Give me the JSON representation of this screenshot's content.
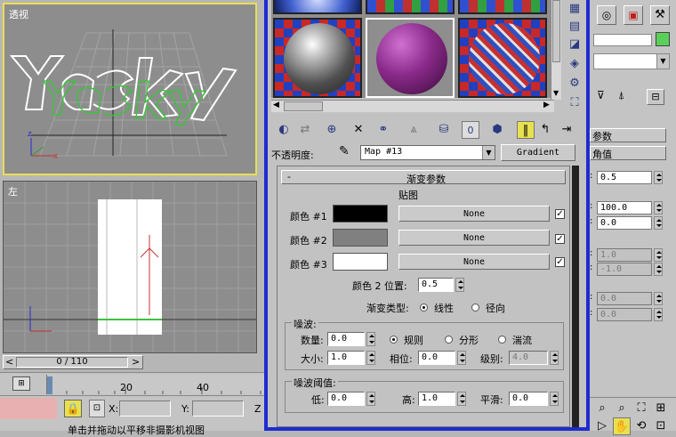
{
  "viewports": {
    "top_label": "透视",
    "bottom_label": "左"
  },
  "timeline": {
    "counter": "0 / 110",
    "tick_20": "20",
    "tick_40": "40"
  },
  "status": {
    "x_label": "X:",
    "y_label": "Y:",
    "z_label": "Z",
    "prompt": "单击并拖动以平移非摄影机视图"
  },
  "material_editor": {
    "opacity_label": "不透明度:",
    "map_name": "Map #13",
    "map_type": "Gradient",
    "rollout_collapse": "-",
    "rollout_title": "渐变参数",
    "maps_header": "贴图",
    "colors": [
      {
        "label": "颜色 #1",
        "swatch": "#000000",
        "map": "None",
        "checked": "✓"
      },
      {
        "label": "颜色 #2",
        "swatch": "#808080",
        "map": "None",
        "checked": "✓"
      },
      {
        "label": "颜色 #3",
        "swatch": "#ffffff",
        "map": "None",
        "checked": "✓"
      }
    ],
    "color2_pos_label": "颜色 2 位置:",
    "color2_pos_value": "0.5",
    "gradient_type_label": "渐变类型:",
    "gradient_types": [
      "线性",
      "径向"
    ],
    "noise_group": "噪波:",
    "amount_label": "数量:",
    "amount_value": "0.0",
    "noise_types": [
      "规则",
      "分形",
      "湍流"
    ],
    "size_label": "大小:",
    "size_value": "1.0",
    "phase_label": "相位:",
    "phase_value": "0.0",
    "levels_label": "级别:",
    "levels_value": "4.0",
    "threshold_group": "噪波阈值:",
    "low_label": "低:",
    "low_value": "0.0",
    "high_label": "高:",
    "high_value": "1.0",
    "smooth_label": "平滑:",
    "smooth_value": "0.0"
  },
  "right_panel": {
    "section1": "参数",
    "section2": "角值",
    "values": [
      "0.5",
      "100.0",
      "0.0",
      "1.0",
      "-1.0",
      "0.0",
      "0.0"
    ],
    "accent": "#5ad05a"
  },
  "colors": {
    "editor_border": "#1e2ccf",
    "viewport_active": "#e8e050",
    "viewport_bg": "#8d8d8d"
  }
}
